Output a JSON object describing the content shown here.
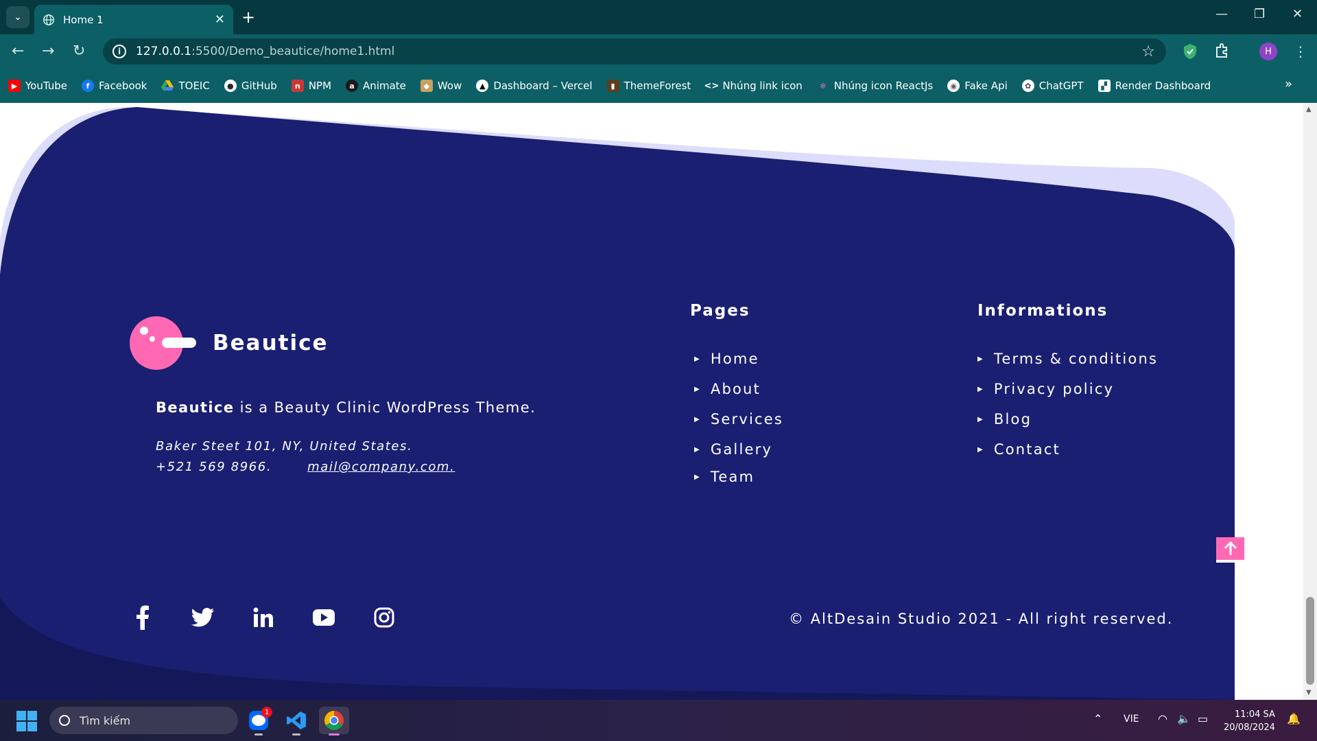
{
  "browser": {
    "tab_title": "Home 1",
    "url_host": "127.0.0.1",
    "url_path": ":5500/Demo_beautice/home1.html",
    "profile_initial": "H",
    "bookmarks": [
      {
        "label": "YouTube",
        "icon": "youtube-icon",
        "color": "#ff0000"
      },
      {
        "label": "Facebook",
        "icon": "facebook-icon",
        "color": "#1877f2"
      },
      {
        "label": "TOEIC",
        "icon": "drive-icon",
        "color": "#fbbc04"
      },
      {
        "label": "GitHub",
        "icon": "github-icon",
        "color": "#24292e"
      },
      {
        "label": "NPM",
        "icon": "npm-icon",
        "color": "#cb3837"
      },
      {
        "label": "Animate",
        "icon": "animate-icon",
        "color": "#1a1a1a"
      },
      {
        "label": "Wow",
        "icon": "wow-icon",
        "color": "#c8a060"
      },
      {
        "label": "Dashboard – Vercel",
        "icon": "vercel-icon",
        "color": "#000000"
      },
      {
        "label": "ThemeForest",
        "icon": "themeforest-icon",
        "color": "#5c3d1e"
      },
      {
        "label": "Nhúng link icon",
        "icon": "code-icon",
        "color": "#0d5f66"
      },
      {
        "label": "Nhúng icon ReactJs",
        "icon": "react-icon",
        "color": "#8a3a8a"
      },
      {
        "label": "Fake Api",
        "icon": "fakeapi-icon",
        "color": "#555555"
      },
      {
        "label": "ChatGPT",
        "icon": "chatgpt-icon",
        "color": "#444444"
      },
      {
        "label": "Render Dashboard",
        "icon": "render-icon",
        "color": "#0d5f66"
      }
    ]
  },
  "footer": {
    "brand_name": "Beautice",
    "about_bold": "Beautice",
    "about_rest": " is a Beauty Clinic WordPress Theme.",
    "address": "Baker Steet 101, NY, United States.",
    "phone": "+521 569 8966.",
    "email": "mail@company.com.",
    "pages_title": "Pages",
    "pages_links": [
      "Home",
      "About",
      "Services",
      "Gallery",
      "Team"
    ],
    "info_title": "Informations",
    "info_links": [
      "Terms & conditions",
      "Privacy policy",
      "Blog",
      "Contact"
    ],
    "socials": [
      "facebook-icon",
      "twitter-icon",
      "linkedin-icon",
      "youtube-icon",
      "instagram-icon"
    ],
    "copyright": "© AltDesain Studio 2021 - All right reserved.",
    "colors": {
      "navy": "#1a1f71",
      "lavender": "#dcdcfc",
      "pink": "#ff69b4"
    }
  },
  "taskbar": {
    "search_placeholder": "Tìm kiếm",
    "zalo_badge": "1",
    "language": "VIE",
    "time": "11:04 SA",
    "date": "20/08/2024"
  }
}
